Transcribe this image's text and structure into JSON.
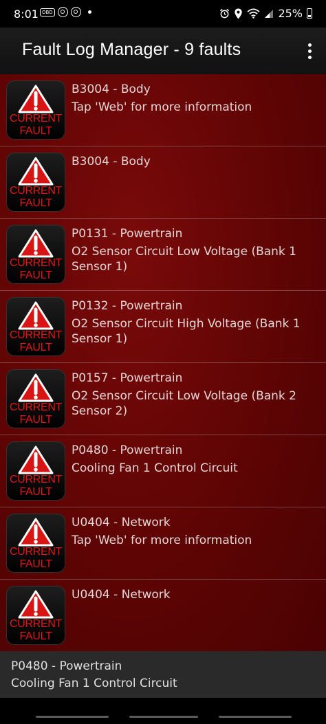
{
  "status_bar": {
    "time": "8:01",
    "obd_label": "OBD",
    "battery": "25%",
    "left_icons": [
      "obd-icon",
      "fingerprint-icon",
      "fingerprint-icon",
      "notification-dot-icon"
    ],
    "right_icons": [
      "alarm-icon",
      "location-icon",
      "wifi-icon",
      "signal-icon",
      "battery-icon"
    ]
  },
  "app_bar": {
    "title": "Fault Log Manager - 9 faults",
    "overflow_icon": "more-vert-icon"
  },
  "badge": {
    "line1": "CURRENT",
    "line2": "FAULT",
    "icon": "warning-triangle-icon"
  },
  "faults": [
    {
      "code": "B3004 - Body",
      "description": "Tap 'Web' for more information"
    },
    {
      "code": "B3004 - Body",
      "description": ""
    },
    {
      "code": "P0131 - Powertrain",
      "description": "O2 Sensor Circuit Low Voltage (Bank 1 Sensor 1)"
    },
    {
      "code": "P0132 - Powertrain",
      "description": "O2 Sensor Circuit High Voltage (Bank 1 Sensor 1)"
    },
    {
      "code": "P0157 - Powertrain",
      "description": "O2 Sensor Circuit Low Voltage (Bank 2 Sensor 2)"
    },
    {
      "code": "P0480 - Powertrain",
      "description": "Cooling Fan 1 Control Circuit"
    },
    {
      "code": "U0404 - Network",
      "description": "Tap 'Web' for more information"
    },
    {
      "code": "U0404 - Network",
      "description": ""
    }
  ],
  "selected_fault": {
    "code": "P0480 - Powertrain",
    "description": "Cooling Fan 1 Control Circuit"
  },
  "colors": {
    "list_background": "#5e0404",
    "badge_text": "#e01818",
    "triangle": "#d91414"
  }
}
